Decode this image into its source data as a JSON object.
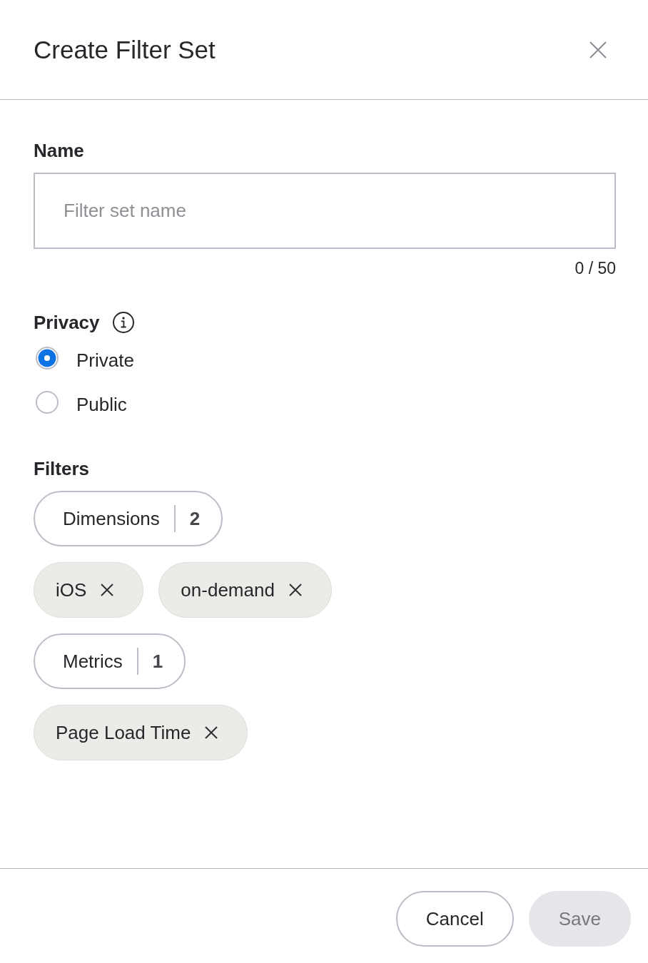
{
  "dialog": {
    "title": "Create Filter Set"
  },
  "name_field": {
    "label": "Name",
    "placeholder": "Filter set name",
    "counter": "0 / 50"
  },
  "privacy": {
    "label": "Privacy",
    "options": [
      {
        "label": "Private",
        "selected": true
      },
      {
        "label": "Public",
        "selected": false
      }
    ]
  },
  "filters": {
    "label": "Filters",
    "groups": [
      {
        "name": "Dimensions",
        "count": "2",
        "tags": [
          {
            "label": "iOS"
          },
          {
            "label": "on-demand"
          }
        ]
      },
      {
        "name": "Metrics",
        "count": "1",
        "tags": [
          {
            "label": "Page Load Time"
          }
        ]
      }
    ]
  },
  "buttons": [
    {
      "label": "Cancel",
      "kind": "secondary",
      "disabled": false
    },
    {
      "label": "Save",
      "kind": "primary",
      "disabled": true
    }
  ]
}
